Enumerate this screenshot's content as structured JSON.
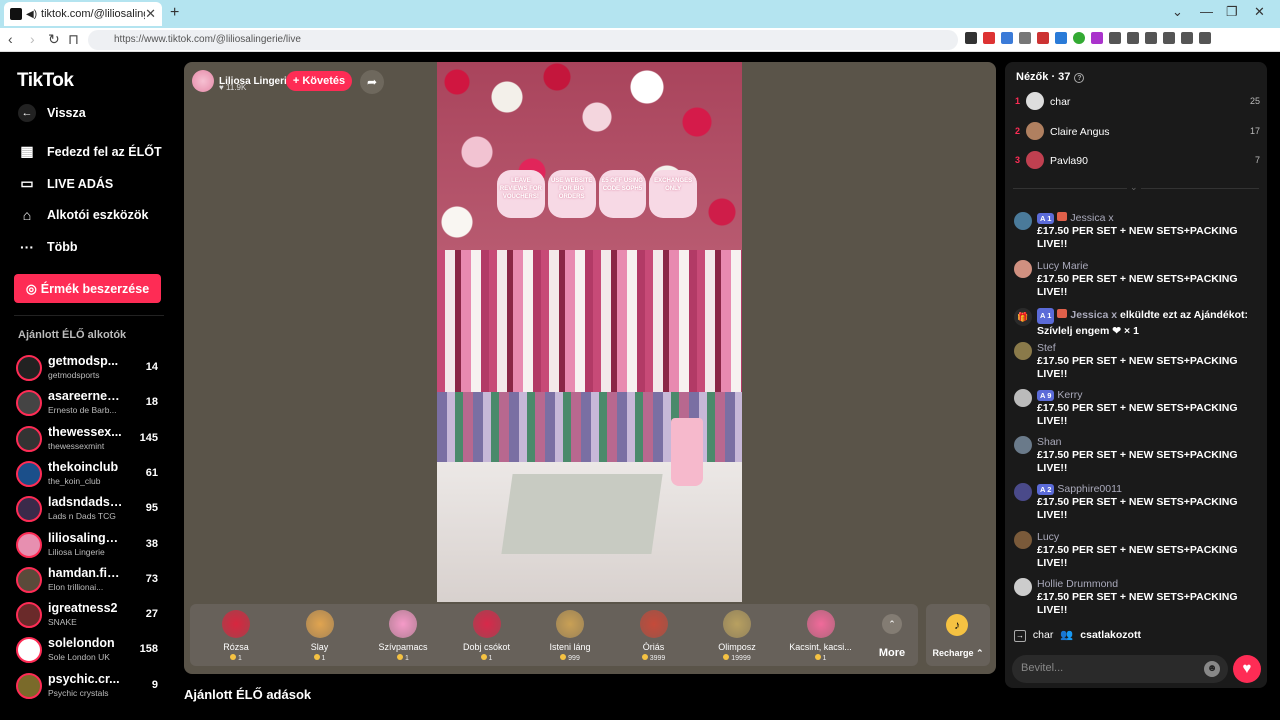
{
  "browser": {
    "tab_title": "tiktok.com/@liliosalingerie/li",
    "url": "https://www.tiktok.com/@liliosalingerie/live"
  },
  "sidebar": {
    "logo": "TikTok",
    "back": "Vissza",
    "items": [
      {
        "label": "Fedezd fel az ÉLŐT",
        "icon": "calendar-icon"
      },
      {
        "label": "LIVE ADÁS",
        "icon": "camera-icon"
      },
      {
        "label": "Alkotói eszközök",
        "icon": "home-tools-icon"
      },
      {
        "label": "Több",
        "icon": "more-dots-icon"
      }
    ],
    "coins_button": "Érmék beszerzése",
    "recommended_title": "Ajánlott ÉLŐ alkotók",
    "creators": [
      {
        "name": "getmodsp...",
        "sub": "getmodsports",
        "count": "14",
        "color": "#222"
      },
      {
        "name": "asareernes...",
        "sub": "Ernesto de Barb...",
        "count": "18",
        "color": "#444"
      },
      {
        "name": "thewessex...",
        "sub": "thewessexmint",
        "count": "145",
        "color": "#333"
      },
      {
        "name": "thekoinclub",
        "sub": "the_koin_club",
        "count": "61",
        "color": "#1b4f8a"
      },
      {
        "name": "ladsndadst...",
        "sub": "Lads n Dads TCG",
        "count": "95",
        "color": "#3a2a4a"
      },
      {
        "name": "liliosalinge...",
        "sub": "Liliosa Lingerie",
        "count": "38",
        "color": "#e78fb0"
      },
      {
        "name": "hamdan.fiz...",
        "sub": "Elon trillionai...",
        "count": "73",
        "color": "#5a4a3a"
      },
      {
        "name": "igreatness2",
        "sub": "SNAKE",
        "count": "27",
        "color": "#6a2a2a"
      },
      {
        "name": "solelondon",
        "sub": "Sole London UK",
        "count": "158",
        "color": "#fff"
      },
      {
        "name": "psychic.cr...",
        "sub": "Psychic crystals",
        "count": "9",
        "color": "#7a6a2a"
      }
    ]
  },
  "stream": {
    "host_name": "Liliosa Lingerie",
    "host_likes": "11.9K",
    "follow_label": "+ Követés",
    "video_signs": [
      "LEAVE REVIEWS FOR VOUCHERS!",
      "USE WEBSITE FOR BIG ORDERS",
      "£5 OFF USING CODE SOPH5",
      "EXCHANGES ONLY"
    ]
  },
  "gifts": [
    {
      "name": "Rózsa",
      "price": "1",
      "color": "#d8263f"
    },
    {
      "name": "Slay",
      "price": "1",
      "color": "#e0a450"
    },
    {
      "name": "Szívpamacs",
      "price": "1",
      "color": "#f59ac8"
    },
    {
      "name": "Dobj csókot",
      "price": "1",
      "color": "#d8284a"
    },
    {
      "name": "Isteni láng",
      "price": "999",
      "color": "#c9a055"
    },
    {
      "name": "Óriás",
      "price": "3999",
      "color": "#c54a3a"
    },
    {
      "name": "Olimposz",
      "price": "19999",
      "color": "#b8a060"
    },
    {
      "name": "Kacsint, kacsi...",
      "price": "1",
      "color": "#f06a9a"
    }
  ],
  "more_label": "More",
  "recharge_label": "Recharge",
  "feed_title": "Ajánlott ÉLŐ adások",
  "panel": {
    "viewers_label": "Nézők · 37",
    "top_viewers": [
      {
        "rank": "1",
        "name": "char",
        "score": "25",
        "color": "#ddd"
      },
      {
        "rank": "2",
        "name": "Claire Angus",
        "score": "17",
        "color": "#b08060"
      },
      {
        "rank": "3",
        "name": "Pavla90",
        "score": "7",
        "color": "#c04050"
      }
    ],
    "messages": [
      {
        "type": "msg",
        "level": "1",
        "name": "Jessica x",
        "text": "£17.50 PER SET + NEW SETS+PACKING LIVE!!",
        "color": "#4a7a9a"
      },
      {
        "type": "msg",
        "level": "",
        "name": "Lucy Marie",
        "text": "£17.50 PER SET + NEW SETS+PACKING LIVE!!",
        "color": "#d09080"
      },
      {
        "type": "gift",
        "level": "1",
        "name": "Jessica x",
        "text": "elküldte ezt az Ajándékot: Szívlelj engem",
        "count": "× 1"
      },
      {
        "type": "msg",
        "level": "",
        "name": "Stef",
        "text": "£17.50 PER SET + NEW SETS+PACKING LIVE!!",
        "color": "#8a7a4a"
      },
      {
        "type": "msg",
        "level": "9",
        "name": "Kerry",
        "text": "£17.50 PER SET + NEW SETS+PACKING LIVE!!",
        "color": "#bbb"
      },
      {
        "type": "msg",
        "level": "",
        "name": "Shan",
        "text": "£17.50 PER SET + NEW SETS+PACKING LIVE!!",
        "color": "#6a7a8a"
      },
      {
        "type": "msg",
        "level": "2",
        "name": "Sapphire0011",
        "text": "£17.50 PER SET + NEW SETS+PACKING LIVE!!",
        "color": "#4a4a8a"
      },
      {
        "type": "msg",
        "level": "",
        "name": "Lucy",
        "text": "£17.50 PER SET + NEW SETS+PACKING LIVE!!",
        "color": "#7a5a3a"
      },
      {
        "type": "msg",
        "level": "",
        "name": "Hollie Drummond",
        "text": "£17.50 PER SET + NEW SETS+PACKING LIVE!!",
        "color": "#ccc"
      }
    ],
    "joined_name": "char",
    "joined_text": "csatlakozott",
    "input_placeholder": "Bevitel..."
  }
}
